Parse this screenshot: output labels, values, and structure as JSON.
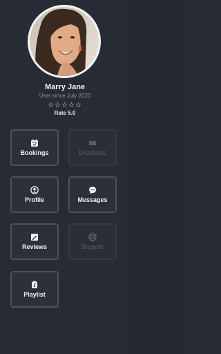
{
  "profile": {
    "name": "Marry Jane",
    "since": "User since July 2020",
    "stars": "☆☆☆☆☆",
    "rating_label": "Rate 5.0"
  },
  "menu": {
    "bookings": "Bookings",
    "discounts": "Discounts",
    "profile": "Profile",
    "messages": "Messages",
    "reviews": "Reviews",
    "support": "Support",
    "playlist": "Playlist"
  },
  "colors": {
    "background": "#262a35",
    "tile_border": "#4a505d",
    "tile_disabled_border": "#363a45",
    "text_primary": "#f1f2f5",
    "text_muted": "#8b909c",
    "text_disabled": "#5a5f6b"
  },
  "icons": {
    "bookings": "calendar-icon",
    "discounts": "ticket-icon",
    "profile": "user-circle-icon",
    "messages": "chat-bubble-icon",
    "reviews": "pen-paper-icon",
    "support": "lifebuoy-icon",
    "playlist": "music-note-icon"
  },
  "tiles_enabled": {
    "bookings": true,
    "discounts": false,
    "profile": true,
    "messages": true,
    "reviews": true,
    "support": false,
    "playlist": true
  }
}
